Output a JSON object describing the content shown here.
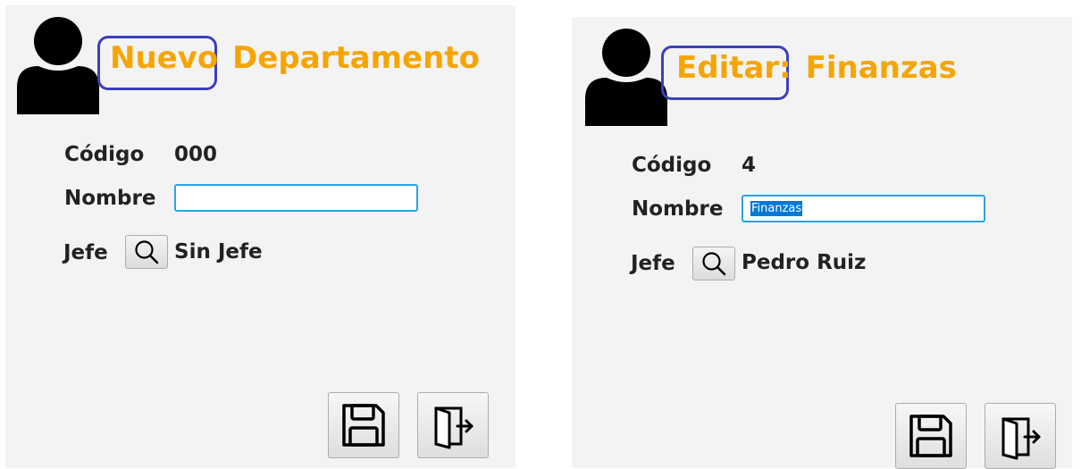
{
  "left": {
    "title_highlight": "Nuevo",
    "title_rest": "Departamento",
    "codigo_label": "Código",
    "codigo_value": "000",
    "nombre_label": "Nombre",
    "nombre_value": "",
    "jefe_label": "Jefe",
    "jefe_value": "Sin Jefe"
  },
  "right": {
    "title_highlight": "Editar:",
    "title_rest": "Finanzas",
    "codigo_label": "Código",
    "codigo_value": "4",
    "nombre_label": "Nombre",
    "nombre_value": "Finanzas",
    "jefe_label": "Jefe",
    "jefe_value": "Pedro Ruiz"
  },
  "icons": {
    "avatar": "user-silhouette-icon",
    "search": "magnifier-icon",
    "save": "floppy-disk-icon",
    "exit": "exit-door-icon"
  },
  "colors": {
    "title": "#f6a500",
    "highlight_border": "#3c3fbe",
    "input_border": "#29a4e6",
    "selection": "#0078d7",
    "panel_bg": "#f3f3f3"
  }
}
